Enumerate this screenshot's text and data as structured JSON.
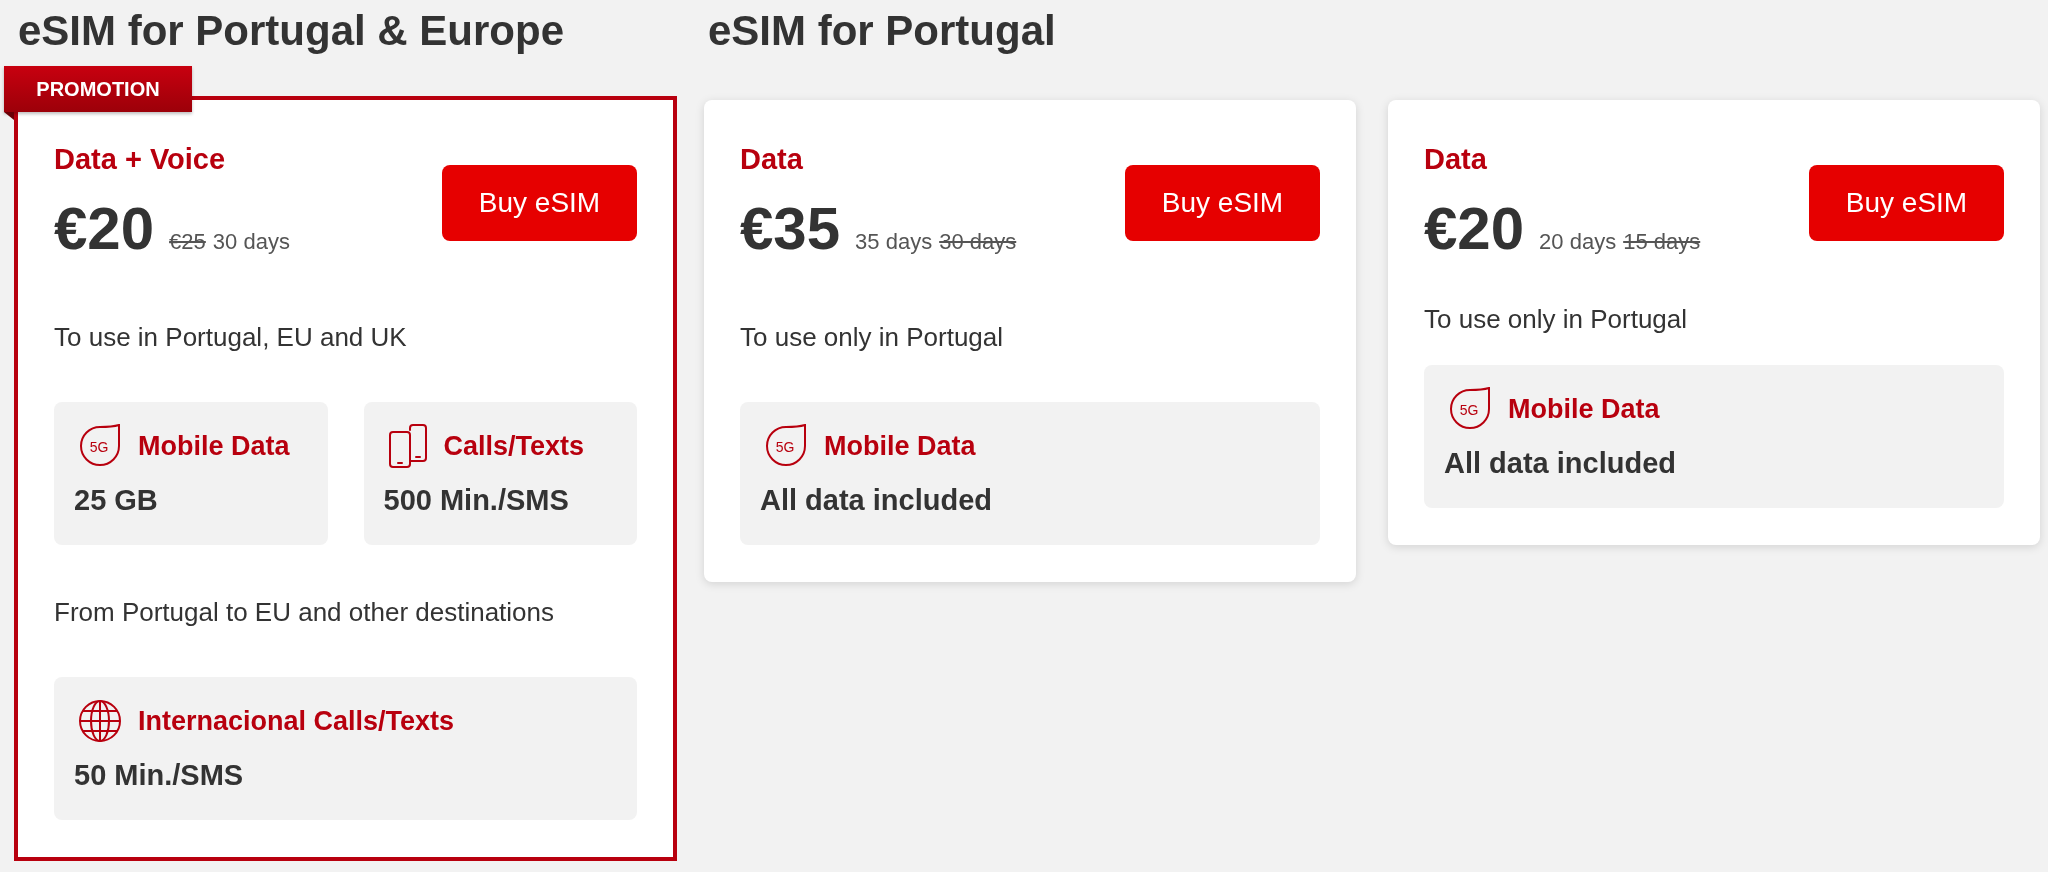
{
  "sections": [
    {
      "heading": "eSIM for Portugal & Europe",
      "cards": [
        {
          "promotion": "PROMOTION",
          "plan": "Data + Voice",
          "price": "€20",
          "price_notes": [
            {
              "text": "€25",
              "struck": true
            },
            {
              "text": "30 days",
              "struck": false
            }
          ],
          "button": "Buy eSIM",
          "groups": [
            {
              "description": "To use in Portugal, EU and UK",
              "features": [
                {
                  "kind": "data",
                  "icon_text": "5G",
                  "title": "Mobile Data",
                  "value": "25 GB"
                },
                {
                  "kind": "calls",
                  "title": "Calls/Texts",
                  "value": "500 Min./SMS"
                }
              ]
            },
            {
              "description": "From Portugal to EU and other destinations",
              "features": [
                {
                  "kind": "international",
                  "title": "Internacional Calls/Texts",
                  "value": "50 Min./SMS"
                }
              ]
            }
          ]
        }
      ]
    },
    {
      "heading": "eSIM for Portugal",
      "cards": [
        {
          "plan": "Data",
          "price": "€35",
          "price_notes": [
            {
              "text": "35 days",
              "struck": false
            },
            {
              "text": "30 days",
              "struck": true
            }
          ],
          "button": "Buy eSIM",
          "groups": [
            {
              "description": "To use only in Portugal",
              "features": [
                {
                  "kind": "data",
                  "icon_text": "5G",
                  "title": "Mobile Data",
                  "value": "All data included"
                }
              ]
            }
          ]
        },
        {
          "plan": "Data",
          "price": "€20",
          "price_notes": [
            {
              "text": "20 days",
              "struck": false
            },
            {
              "text": "15 days",
              "struck": true
            }
          ],
          "button": "Buy eSIM",
          "groups": [
            {
              "description": "To use only in Portugal",
              "features": [
                {
                  "kind": "data",
                  "icon_text": "5G",
                  "title": "Mobile Data",
                  "value": "All data included"
                }
              ]
            }
          ]
        }
      ]
    }
  ]
}
